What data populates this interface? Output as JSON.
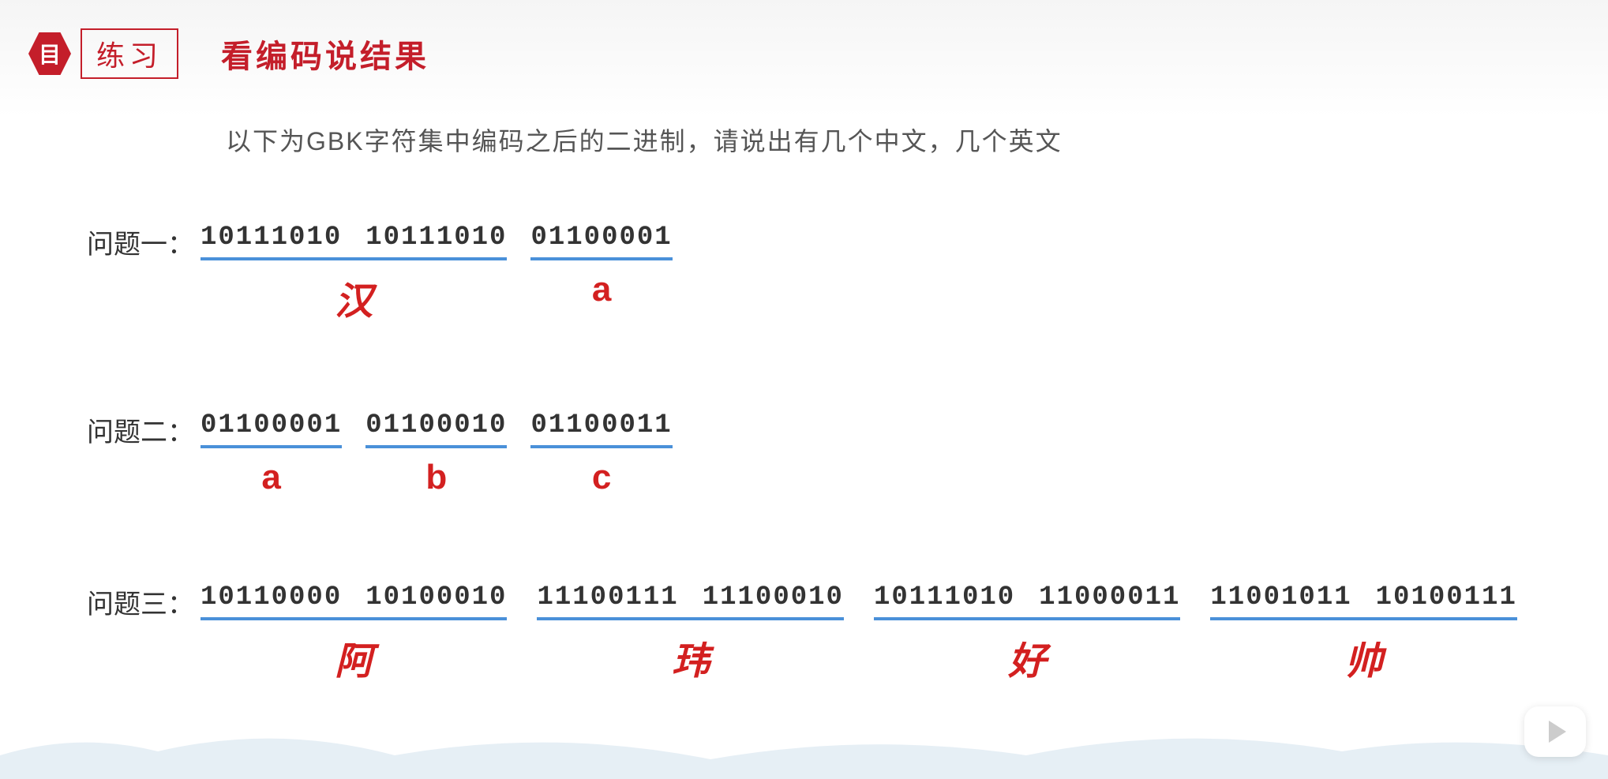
{
  "header": {
    "icon_glyph": "目",
    "practice_label": "练习",
    "title": "看编码说结果"
  },
  "subtitle": "以下为GBK字符集中编码之后的二进制，请说出有几个中文，几个英文",
  "questions": [
    {
      "label": "问题一：",
      "groups": [
        {
          "bytes": [
            "10111010",
            "10111010"
          ],
          "answer": "汉",
          "kind": "cn"
        },
        {
          "bytes": [
            "01100001"
          ],
          "answer": "a",
          "kind": "ascii"
        }
      ]
    },
    {
      "label": "问题二：",
      "groups": [
        {
          "bytes": [
            "01100001"
          ],
          "answer": "a",
          "kind": "ascii"
        },
        {
          "bytes": [
            "01100010"
          ],
          "answer": "b",
          "kind": "ascii"
        },
        {
          "bytes": [
            "01100011"
          ],
          "answer": "c",
          "kind": "ascii"
        }
      ]
    },
    {
      "label": "问题三：",
      "groups": [
        {
          "bytes": [
            "10110000",
            "10100010"
          ],
          "answer": "阿",
          "kind": "cn"
        },
        {
          "bytes": [
            "11100111",
            "11100010"
          ],
          "answer": "玮",
          "kind": "cn"
        },
        {
          "bytes": [
            "10111010",
            "11000011"
          ],
          "answer": "好",
          "kind": "cn"
        },
        {
          "bytes": [
            "11001011",
            "10100111"
          ],
          "answer": "帅",
          "kind": "cn"
        }
      ]
    }
  ]
}
